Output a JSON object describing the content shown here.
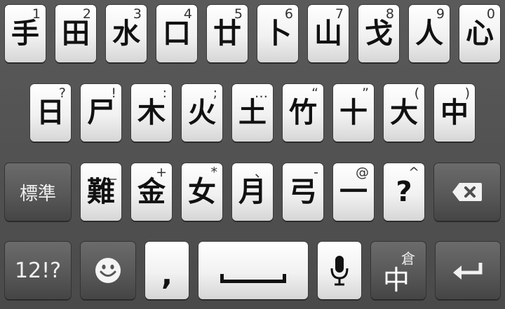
{
  "row1": [
    {
      "char": "手",
      "hint": "1"
    },
    {
      "char": "田",
      "hint": "2"
    },
    {
      "char": "水",
      "hint": "3"
    },
    {
      "char": "口",
      "hint": "4"
    },
    {
      "char": "廿",
      "hint": "5"
    },
    {
      "char": "卜",
      "hint": "6"
    },
    {
      "char": "山",
      "hint": "7"
    },
    {
      "char": "戈",
      "hint": "8"
    },
    {
      "char": "人",
      "hint": "9"
    },
    {
      "char": "心",
      "hint": "0"
    }
  ],
  "row2": [
    {
      "char": "日",
      "hint": "?"
    },
    {
      "char": "尸",
      "hint": "!"
    },
    {
      "char": "木",
      "hint": ":"
    },
    {
      "char": "火",
      "hint": ";"
    },
    {
      "char": "土",
      "hint": "…"
    },
    {
      "char": "竹",
      "hint": "“"
    },
    {
      "char": "十",
      "hint": "”"
    },
    {
      "char": "大",
      "hint": "("
    },
    {
      "char": "中",
      "hint": ")"
    }
  ],
  "row3": {
    "mode_label": "標準",
    "keys": [
      {
        "char": "難",
        "hint": "_"
      },
      {
        "char": "金",
        "hint": "+"
      },
      {
        "char": "女",
        "hint": "*"
      },
      {
        "char": "月",
        "hint": "、"
      },
      {
        "char": "弓",
        "hint": "-"
      },
      {
        "char": "一",
        "hint": "@"
      },
      {
        "char": "?",
        "hint": "^"
      }
    ]
  },
  "row4": {
    "symbols_label": "12!?",
    "comma_label": ",",
    "input_method_small": "倉",
    "input_method_big": "中"
  },
  "icons": {
    "backspace": "backspace-icon",
    "emoji": "smiley-icon",
    "space": "space-icon",
    "mic": "microphone-icon",
    "enter": "enter-icon"
  }
}
